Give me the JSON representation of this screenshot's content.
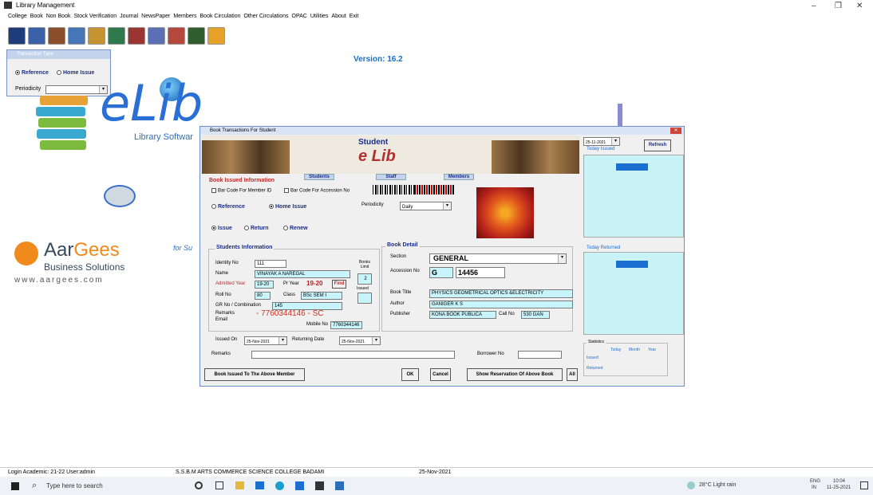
{
  "window": {
    "title": "Library Management"
  },
  "menu": [
    "College",
    "Book",
    "Non Book",
    "Stock Verification",
    "Journal",
    "NewsPaper",
    "Members",
    "Book Circulation",
    "Other Circulations",
    "OPAC",
    "Utilities",
    "About",
    "Exit"
  ],
  "version": "Version: 16.2",
  "transaction_type": {
    "title": "Transaction Type",
    "option_reference": "Reference",
    "option_home_issue": "Home Issue",
    "periodicity_label": "Periodicity",
    "periodicity_value": ""
  },
  "branding": {
    "logo_text": "eLib",
    "tagline": "Library Softwar",
    "company_1": "Aar",
    "company_2": "Gees",
    "company_sub": "Business Solutions",
    "company_url": "www.aargees.com",
    "for_text": "for Su"
  },
  "dialog": {
    "title": "Book Transactions For Student",
    "header_title": "Student",
    "header_logo": "e Lib",
    "date": "25-11-2021",
    "today_issued": "Today Issued",
    "refresh": "Refresh",
    "today_returned": "Today Returned",
    "tabs": {
      "students": "Students",
      "staff": "Staff",
      "members": "Members"
    },
    "book_issued_info": "Book Issued Information",
    "barcode_member": "Bar Code For Member ID",
    "barcode_accession": "Bar Code For Accession No",
    "reference": "Reference",
    "home_issue": "Home Issue",
    "periodicity_label": "Periodicity",
    "periodicity_value": "Daily",
    "issue": "Issue",
    "return": "Return",
    "renew": "Renew",
    "students_info": {
      "title": "Students Information",
      "identity_label": "Identity No",
      "identity": "111",
      "name_label": "Name",
      "name": "VINAYAK A NAREGAL",
      "admitted_label": "Admitted Year",
      "admitted": "19-20",
      "pryear_label": "Pr Year",
      "pryear": "19-20",
      "find": "Find",
      "books_limit": "Books Limit",
      "limit_value": "2",
      "issued": "Issued",
      "issued_value": "",
      "roll_label": "Roll No",
      "roll": "80",
      "class_label": "Class",
      "class": "BSc SEM I",
      "gr_label": "GR No / Combination",
      "gr": "145",
      "remarks_label": "Remarks",
      "email_label": "Email",
      "phone": "- 7760344146 - SC",
      "mobile_label": "Mobile No",
      "mobile": "7760344146"
    },
    "book_detail": {
      "title": "Book Detail",
      "section_label": "Section",
      "section": "GENERAL",
      "accession_label": "Accession No",
      "acc_prefix": "G",
      "accession": "14456",
      "book_title_label": "Book Title",
      "book_title": "PHYSICS GEOMETRICAL OPTICS &ELECTRICITY",
      "author_label": "Author",
      "author": "GANIGER K S",
      "publisher_label": "Publisher",
      "publisher": "KONA BOOK PUBLICA",
      "callno_label": "Call No",
      "callno": "530 GAN"
    },
    "issued_on_label": "Issued On",
    "issued_on": "25-Nov-2021",
    "returning_label": "Returning Date",
    "returning": "25-Nov-2021",
    "remarks_label": "Remarks",
    "borrower_label": "Borrower No",
    "statistics": {
      "title": "Statistics",
      "today": "Today",
      "month": "Month",
      "year": "Year",
      "issued": "Issued",
      "returned": "Returned",
      "dots": "..."
    },
    "buttons": {
      "books_issued": "Book Issued To The Above Member",
      "ok": "OK",
      "cancel": "Cancel",
      "show_reservation": "Show Reservation Of Above Book",
      "all": "All"
    }
  },
  "status": {
    "login": "Login Academic: 21-22  User:admin",
    "college": "S.S.B.M ARTS COMMERCE SCIENCE COLLEGE BADAMI",
    "date": "25-Nov-2021"
  },
  "taskbar": {
    "search_placeholder": "Type here to search",
    "weather": "28°C  Light rain",
    "lang1": "ENG",
    "lang2": "IN",
    "time": "10:04",
    "date": "11-25-2021"
  }
}
